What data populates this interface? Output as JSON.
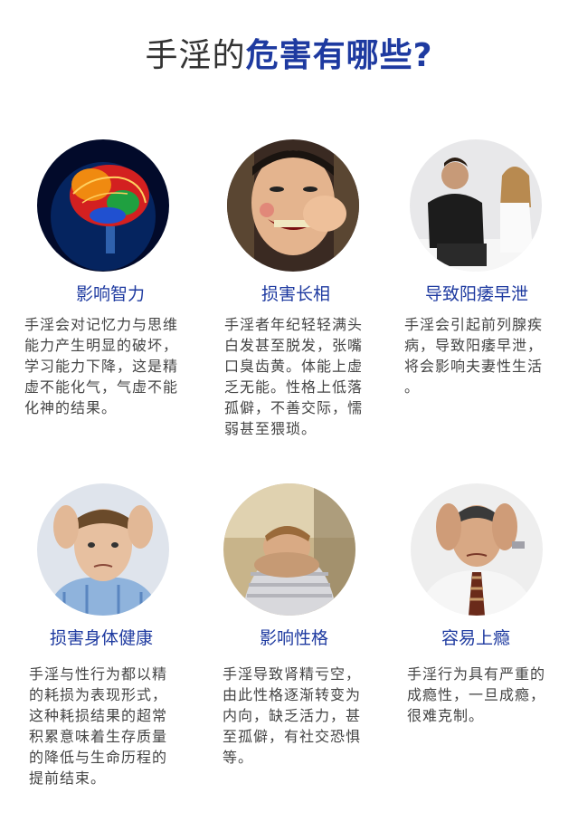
{
  "header": {
    "title_part1": "手淫的",
    "title_part2": "危害有哪些?"
  },
  "items": [
    {
      "title": "影响智力",
      "desc": "手淫会对记忆力与思维\n能力产生明显的破坏，\n学习能力下降，这是精\n虚不能化气，气虚不能\n化神的结果。",
      "icon": "brain-icon"
    },
    {
      "title": "损害长相",
      "desc": "手淫者年纪轻轻满头\n白发甚至脱发，张嘴\n口臭齿黄。体能上虚\n乏无能。性格上低落\n孤僻，不善交际，懦\n弱甚至猥琐。",
      "icon": "grimacing-face-icon"
    },
    {
      "title": "导致阳痿早泄",
      "desc": "手淫会引起前列腺疾\n病，导致阳痿早泄，\n将会影响夫妻性生活\n。",
      "icon": "couple-icon"
    },
    {
      "title": "损害身体健康",
      "desc": "手淫与性行为都以精\n的耗损为表现形式，\n这种耗损结果的超常\n积累意味着生存质量\n的降低与生命历程的\n提前结束。",
      "icon": "stressed-man-icon"
    },
    {
      "title": "影响性格",
      "desc": "手淫导致肾精亏空，\n由此性格逐渐转变为\n内向，缺乏活力，甚\n至孤僻，有社交恐惧\n等。",
      "icon": "sad-man-icon"
    },
    {
      "title": "容易上瘾",
      "desc": "手淫行为具有严重的\n成瘾性，一旦成瘾，\n很难克制。",
      "icon": "worried-man-icon"
    }
  ]
}
